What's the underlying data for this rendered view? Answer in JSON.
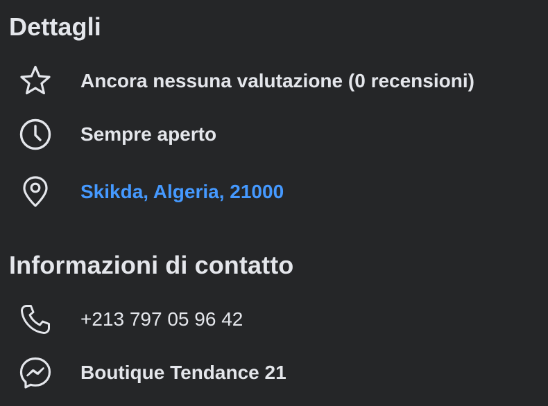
{
  "details": {
    "title": "Dettagli",
    "rating_text": "Ancora nessuna valutazione (0 recensioni)",
    "hours_text": "Sempre aperto",
    "address_text": "Skikda, Algeria, 21000"
  },
  "contact": {
    "title": "Informazioni di contatto",
    "phone_text": "+213 797 05 96 42",
    "messenger_text": "Boutique Tendance 21"
  },
  "colors": {
    "background": "#252628",
    "text": "#e4e6eb",
    "link": "#4599ff"
  },
  "icons": [
    "star-icon",
    "clock-icon",
    "location-pin-icon",
    "phone-icon",
    "messenger-icon"
  ]
}
